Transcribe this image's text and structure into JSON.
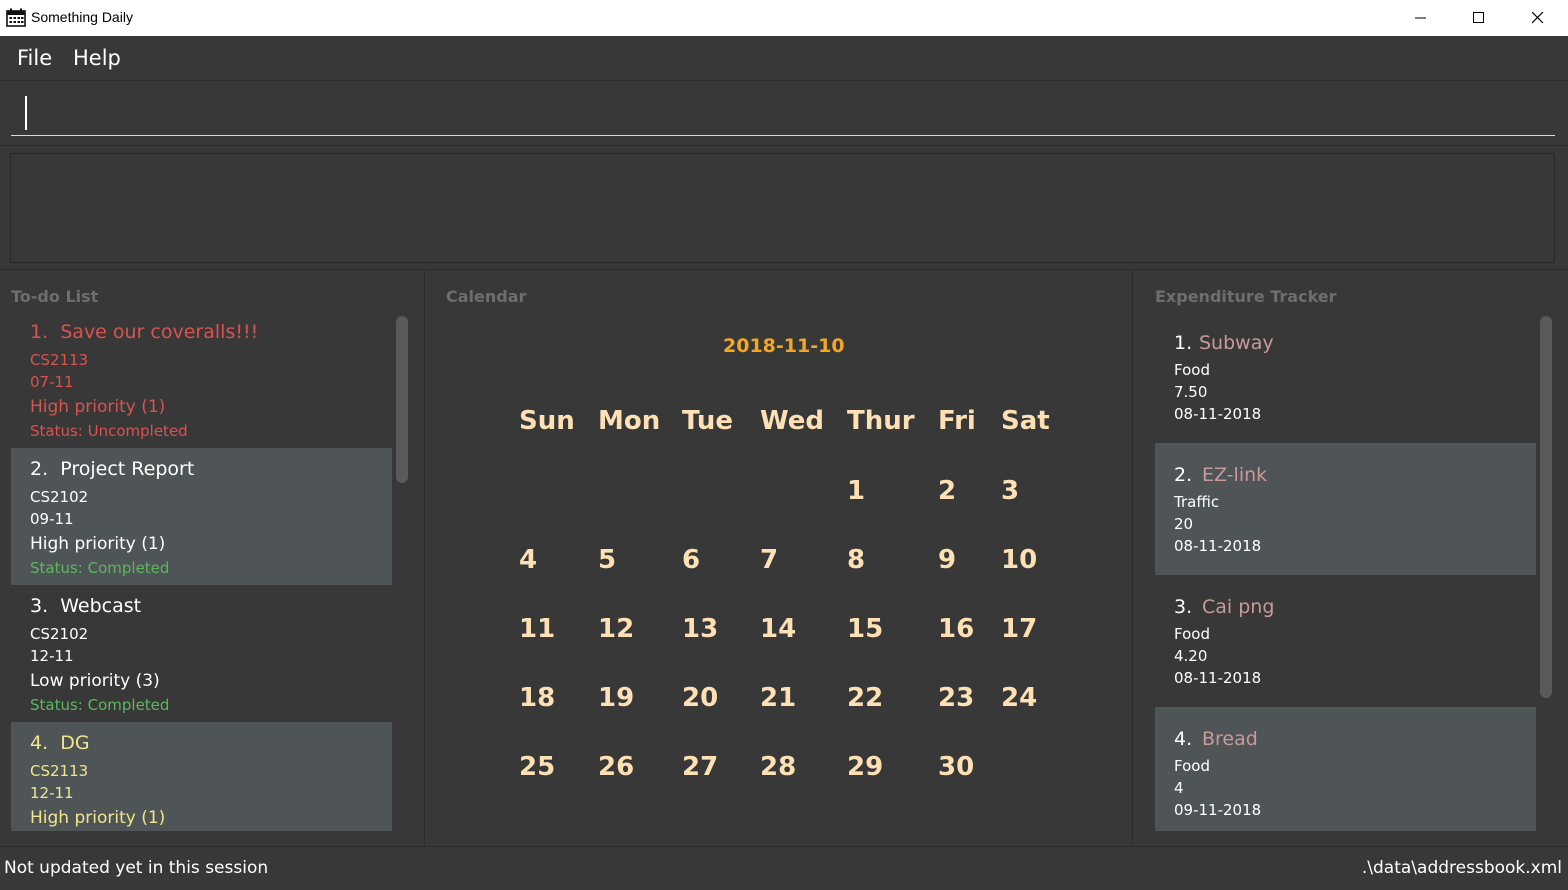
{
  "window": {
    "title": "Something Daily",
    "icon": "calendar-icon",
    "controls": [
      "minimize-icon",
      "maximize-icon",
      "close-icon"
    ]
  },
  "menu": {
    "file": "File",
    "help": "Help"
  },
  "command": {
    "value": ""
  },
  "result": {
    "text": ""
  },
  "todo": {
    "title": "To-do List",
    "items": [
      {
        "index": "1.",
        "name": "Save our coveralls!!!",
        "module": "CS2113",
        "date": "07-11",
        "priority": "High priority (1)",
        "status": "Status: Uncompleted"
      },
      {
        "index": "2.",
        "name": "Project Report",
        "module": "CS2102",
        "date": "09-11",
        "priority": "High priority (1)",
        "status": "Status: Completed"
      },
      {
        "index": "3.",
        "name": "Webcast",
        "module": "CS2102",
        "date": "12-11",
        "priority": "Low priority (3)",
        "status": "Status: Completed"
      },
      {
        "index": "4.",
        "name": "DG",
        "module": "CS2113",
        "date": "12-11",
        "priority": "High priority (1)",
        "status": ""
      }
    ]
  },
  "calendar": {
    "title": "Calendar",
    "date": "2018-11-10",
    "weekdays": [
      "Sun",
      "Mon",
      "Tue",
      "Wed",
      "Thur",
      "Fri",
      "Sat"
    ],
    "days": [
      "1",
      "2",
      "3",
      "4",
      "5",
      "6",
      "7",
      "8",
      "9",
      "10",
      "11",
      "12",
      "13",
      "14",
      "15",
      "16",
      "17",
      "18",
      "19",
      "20",
      "21",
      "22",
      "23",
      "24",
      "25",
      "26",
      "27",
      "28",
      "29",
      "30"
    ]
  },
  "expenditure": {
    "title": "Expenditure Tracker",
    "items": [
      {
        "index": "1.",
        "name": "Subway",
        "category": "Food",
        "amount": "7.50",
        "date": "08-11-2018"
      },
      {
        "index": "2.",
        "name": "EZ-link",
        "category": "Traffic",
        "amount": "20",
        "date": "08-11-2018"
      },
      {
        "index": "3.",
        "name": "Cai png",
        "category": "Food",
        "amount": "4.20",
        "date": "08-11-2018"
      },
      {
        "index": "4.",
        "name": "Bread",
        "category": "Food",
        "amount": "4",
        "date": "09-11-2018"
      }
    ]
  },
  "status": {
    "left": "Not updated yet in this session",
    "right": ".\\data\\addressbook.xml"
  },
  "colors": {
    "background": "#383838",
    "card_alt": "#4f5457",
    "red": "#d9534f",
    "green": "#5cb85c",
    "yellow": "#f0e68c",
    "calendar_date": "#f5a623",
    "calendar_text": "#fde0b4",
    "expense_name": "#c89a9a"
  }
}
